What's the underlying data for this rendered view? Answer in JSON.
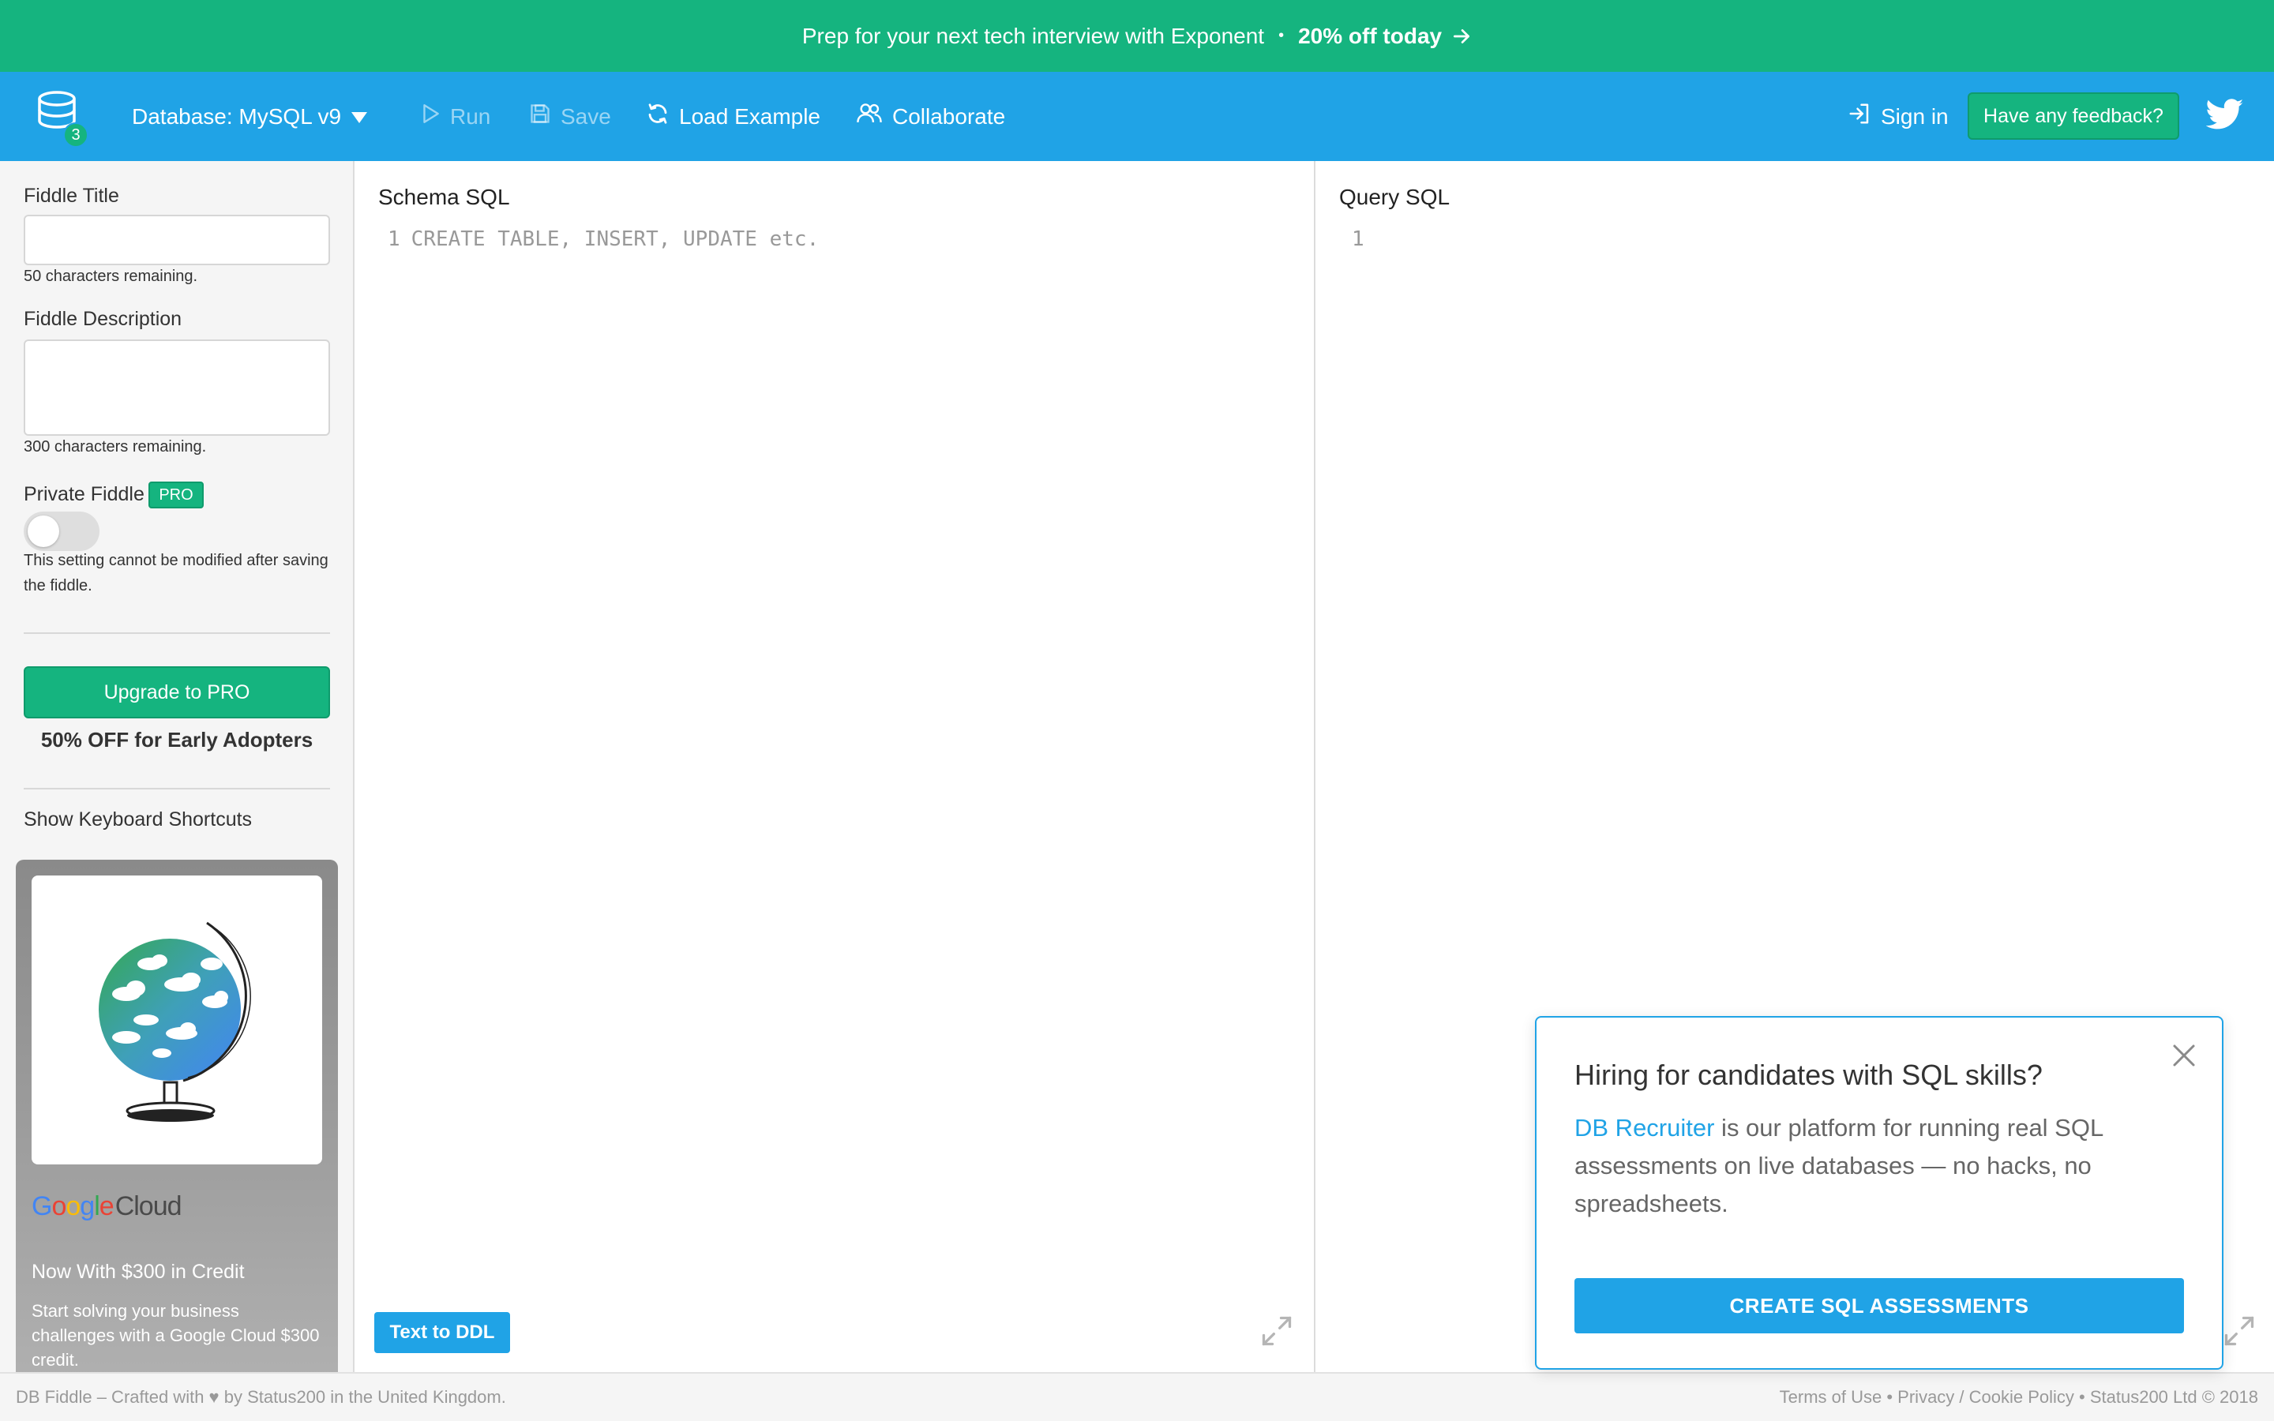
{
  "promo": {
    "text": "Prep for your next tech interview with Exponent",
    "separator": "•",
    "offer": "20% off today"
  },
  "nav": {
    "logo_badge": "3",
    "database": "Database: MySQL v9",
    "run": "Run",
    "save": "Save",
    "load_example": "Load Example",
    "collaborate": "Collaborate",
    "sign_in": "Sign in",
    "feedback": "Have any feedback?"
  },
  "sidebar": {
    "title_label": "Fiddle Title",
    "title_value": "",
    "title_remaining": "50 characters remaining.",
    "description_label": "Fiddle Description",
    "description_value": "",
    "description_remaining": "300 characters remaining.",
    "private_label": "Private Fiddle",
    "pro_badge": "PRO",
    "private_enabled": false,
    "private_note": "This setting cannot be modified after saving the fiddle.",
    "upgrade_button": "Upgrade to PRO",
    "early_adopters": "50% OFF for Early Adopters",
    "shortcuts": "Show Keyboard Shortcuts"
  },
  "ad": {
    "logo_google": [
      "G",
      "o",
      "o",
      "g",
      "l",
      "e"
    ],
    "logo_cloud": "Cloud",
    "title": "Now With $300 in Credit",
    "text": "Start solving your business challenges with a Google Cloud $300 credit."
  },
  "schema_editor": {
    "title": "Schema SQL",
    "line_number": "1",
    "placeholder": "CREATE TABLE, INSERT, UPDATE etc.",
    "text_to_ddl": "Text to DDL"
  },
  "query_editor": {
    "title": "Query SQL",
    "line_number": "1",
    "content": ""
  },
  "popup": {
    "title": "Hiring for candidates with SQL skills?",
    "link": "DB Recruiter",
    "text": " is our platform for running real SQL assessments on live databases — no hacks, no spreadsheets.",
    "button": "CREATE SQL ASSESSMENTS"
  },
  "footer": {
    "left": "DB Fiddle – Crafted with ♥ by Status200 in the United Kingdom.",
    "right": "Terms of Use • Privacy / Cookie Policy • Status200 Ltd © 2018"
  },
  "colors": {
    "promo_green": "#15b47f",
    "nav_blue": "#20a3e6",
    "sidebar_bg": "#f5f5f5"
  },
  "icons": {
    "logo": "database-icon",
    "dropdown": "caret-down-icon",
    "run": "play-icon",
    "save": "floppy-disk-icon",
    "load": "refresh-icon",
    "collaborate": "users-icon",
    "sign_in": "sign-in-icon",
    "twitter": "twitter-icon",
    "expand": "expand-icon",
    "close": "close-icon",
    "ad_image": "globe-icon"
  }
}
